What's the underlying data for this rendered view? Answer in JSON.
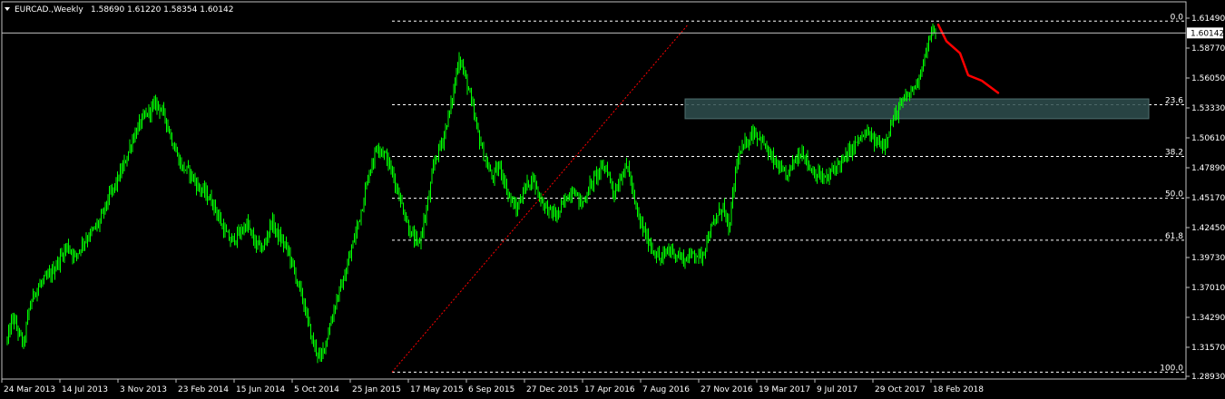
{
  "header": {
    "symbol": "EURCAD.,Weekly",
    "ohlc": "1.58690 1.61220 1.58354 1.60142"
  },
  "colors": {
    "background": "#000000",
    "candle": "#00ff00",
    "grid": "#ffffff",
    "fib": "#ffffff",
    "trendline": "#ff0000",
    "zone": "#2f4f4f",
    "projection": "#ff0000",
    "price_line": "#c0c0c0"
  },
  "chart_data": {
    "type": "candlestick",
    "symbol": "EURCAD.",
    "timeframe": "Weekly",
    "current_price": "1.60142",
    "price_axis_ticks": [
      "1.61490",
      "1.58770",
      "1.56050",
      "1.53330",
      "1.50610",
      "1.47890",
      "1.45170",
      "1.42450",
      "1.39730",
      "1.37010",
      "1.34290",
      "1.31570",
      "1.28930"
    ],
    "time_axis_ticks": [
      "24 Mar 2013",
      "14 Jul 2013",
      "3 Nov 2013",
      "23 Feb 2014",
      "15 Jun 2014",
      "5 Oct 2014",
      "25 Jan 2015",
      "17 May 2015",
      "6 Sep 2015",
      "27 Dec 2015",
      "17 Apr 2016",
      "7 Aug 2016",
      "27 Nov 2016",
      "19 Mar 2017",
      "9 Jul 2017",
      "29 Oct 2017",
      "18 Feb 2018"
    ],
    "ylim": [
      1.2893,
      1.6215
    ],
    "fibonacci": {
      "levels": [
        {
          "label": "0.0",
          "price": 1.6122
        },
        {
          "label": "23.6",
          "price": 1.5362
        },
        {
          "label": "38.2",
          "price": 1.4892
        },
        {
          "label": "50.0",
          "price": 1.4512
        },
        {
          "label": "61.8",
          "price": 1.4131
        },
        {
          "label": "100.0",
          "price": 1.2931
        }
      ]
    },
    "resistance_zone": {
      "low": 1.5235,
      "high": 1.5415
    },
    "trendline": {
      "from_price": 1.2931,
      "to_price": 1.6122
    },
    "path_points": [
      [
        0,
        1.322
      ],
      [
        4,
        1.343
      ],
      [
        8,
        1.33
      ],
      [
        12,
        1.318
      ],
      [
        16,
        1.35
      ],
      [
        20,
        1.366
      ],
      [
        26,
        1.375
      ],
      [
        32,
        1.382
      ],
      [
        38,
        1.395
      ],
      [
        44,
        1.408
      ],
      [
        50,
        1.398
      ],
      [
        56,
        1.412
      ],
      [
        62,
        1.42
      ],
      [
        68,
        1.43
      ],
      [
        74,
        1.45
      ],
      [
        80,
        1.465
      ],
      [
        86,
        1.482
      ],
      [
        92,
        1.505
      ],
      [
        98,
        1.52
      ],
      [
        104,
        1.53
      ],
      [
        110,
        1.538
      ],
      [
        116,
        1.525
      ],
      [
        122,
        1.5
      ],
      [
        128,
        1.48
      ],
      [
        134,
        1.475
      ],
      [
        140,
        1.462
      ],
      [
        146,
        1.455
      ],
      [
        152,
        1.445
      ],
      [
        158,
        1.425
      ],
      [
        164,
        1.412
      ],
      [
        170,
        1.418
      ],
      [
        176,
        1.428
      ],
      [
        182,
        1.41
      ],
      [
        188,
        1.405
      ],
      [
        194,
        1.43
      ],
      [
        200,
        1.415
      ],
      [
        206,
        1.405
      ],
      [
        212,
        1.38
      ],
      [
        218,
        1.355
      ],
      [
        224,
        1.322
      ],
      [
        230,
        1.305
      ],
      [
        236,
        1.33
      ],
      [
        242,
        1.36
      ],
      [
        248,
        1.38
      ],
      [
        254,
        1.41
      ],
      [
        260,
        1.44
      ],
      [
        266,
        1.475
      ],
      [
        272,
        1.5
      ],
      [
        278,
        1.49
      ],
      [
        284,
        1.47
      ],
      [
        290,
        1.445
      ],
      [
        296,
        1.42
      ],
      [
        302,
        1.408
      ],
      [
        308,
        1.44
      ],
      [
        314,
        1.485
      ],
      [
        320,
        1.505
      ],
      [
        326,
        1.535
      ],
      [
        332,
        1.58
      ],
      [
        338,
        1.555
      ],
      [
        344,
        1.52
      ],
      [
        350,
        1.49
      ],
      [
        356,
        1.47
      ],
      [
        362,
        1.48
      ],
      [
        368,
        1.455
      ],
      [
        374,
        1.44
      ],
      [
        380,
        1.46
      ],
      [
        386,
        1.47
      ],
      [
        392,
        1.45
      ],
      [
        398,
        1.44
      ],
      [
        404,
        1.435
      ],
      [
        410,
        1.45
      ],
      [
        416,
        1.46
      ],
      [
        422,
        1.445
      ],
      [
        428,
        1.462
      ],
      [
        434,
        1.475
      ],
      [
        440,
        1.48
      ],
      [
        446,
        1.455
      ],
      [
        452,
        1.475
      ],
      [
        456,
        1.48
      ],
      [
        462,
        1.44
      ],
      [
        468,
        1.42
      ],
      [
        474,
        1.405
      ],
      [
        480,
        1.395
      ],
      [
        486,
        1.405
      ],
      [
        492,
        1.4
      ],
      [
        498,
        1.395
      ],
      [
        504,
        1.402
      ],
      [
        510,
        1.398
      ],
      [
        516,
        1.42
      ],
      [
        522,
        1.435
      ],
      [
        526,
        1.445
      ],
      [
        530,
        1.42
      ],
      [
        536,
        1.485
      ],
      [
        542,
        1.5
      ],
      [
        548,
        1.512
      ],
      [
        554,
        1.505
      ],
      [
        560,
        1.49
      ],
      [
        566,
        1.48
      ],
      [
        572,
        1.47
      ],
      [
        578,
        1.485
      ],
      [
        584,
        1.495
      ],
      [
        590,
        1.478
      ],
      [
        596,
        1.472
      ],
      [
        602,
        1.468
      ],
      [
        608,
        1.48
      ],
      [
        614,
        1.485
      ],
      [
        620,
        1.495
      ],
      [
        626,
        1.505
      ],
      [
        632,
        1.51
      ],
      [
        638,
        1.502
      ],
      [
        644,
        1.5
      ],
      [
        650,
        1.52
      ],
      [
        656,
        1.535
      ],
      [
        662,
        1.545
      ],
      [
        668,
        1.555
      ],
      [
        674,
        1.58
      ],
      [
        680,
        1.605
      ],
      [
        682,
        1.60142
      ]
    ],
    "projection_path": [
      [
        684,
        1.609
      ],
      [
        690,
        1.594
      ],
      [
        700,
        1.583
      ],
      [
        706,
        1.563
      ],
      [
        716,
        1.558
      ],
      [
        728,
        1.547
      ]
    ]
  }
}
